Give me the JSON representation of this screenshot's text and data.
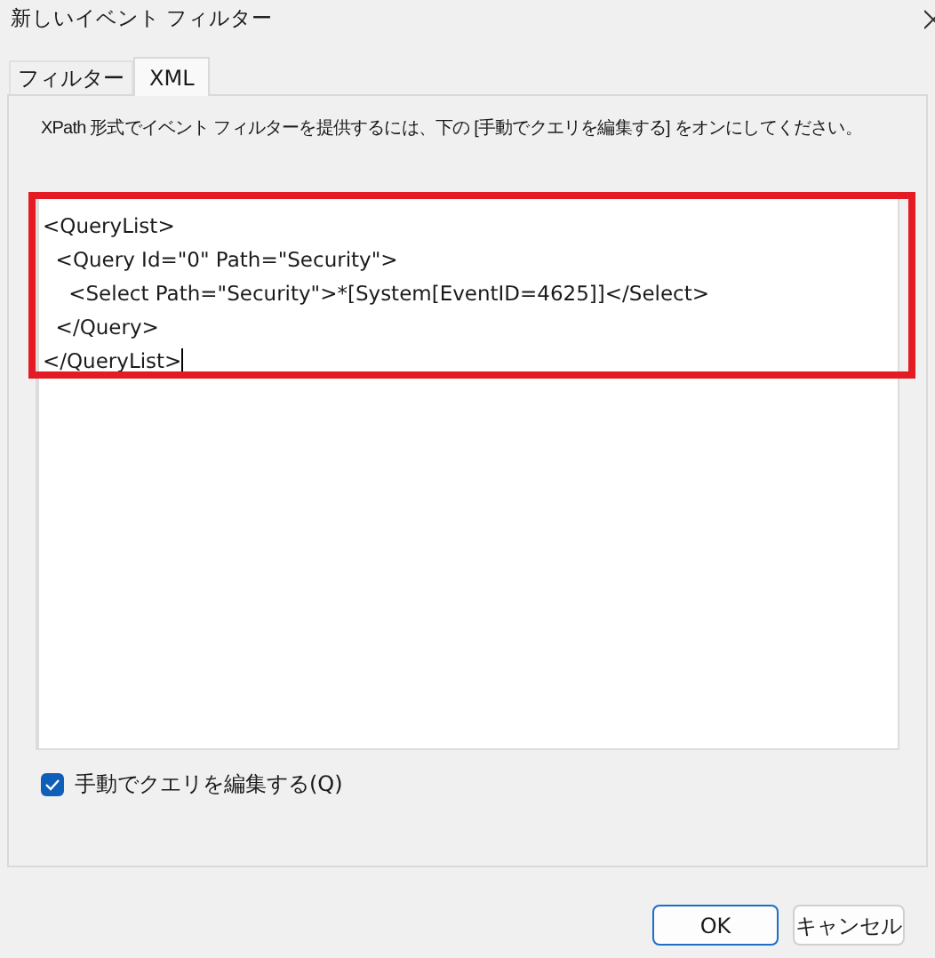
{
  "window": {
    "title": "新しいイベント フィルター"
  },
  "tabs": [
    {
      "label": "フィルター",
      "selected": false
    },
    {
      "label": "XML",
      "selected": true
    }
  ],
  "instruction": "XPath 形式でイベント フィルターを提供するには、下の [手動でクエリを編集する] をオンにしてください。",
  "editor": {
    "lines": [
      "<QueryList>",
      "  <Query Id=\"0\" Path=\"Security\">",
      "    <Select Path=\"Security\">*[System[EventID=4625]]</Select>",
      "  </Query>",
      "</QueryList>"
    ]
  },
  "checkbox": {
    "label": "手動でクエリを編集する(Q)",
    "checked": true
  },
  "buttons": [
    {
      "label": "OK",
      "default": true
    },
    {
      "label": "キャンセル",
      "default": false
    }
  ]
}
